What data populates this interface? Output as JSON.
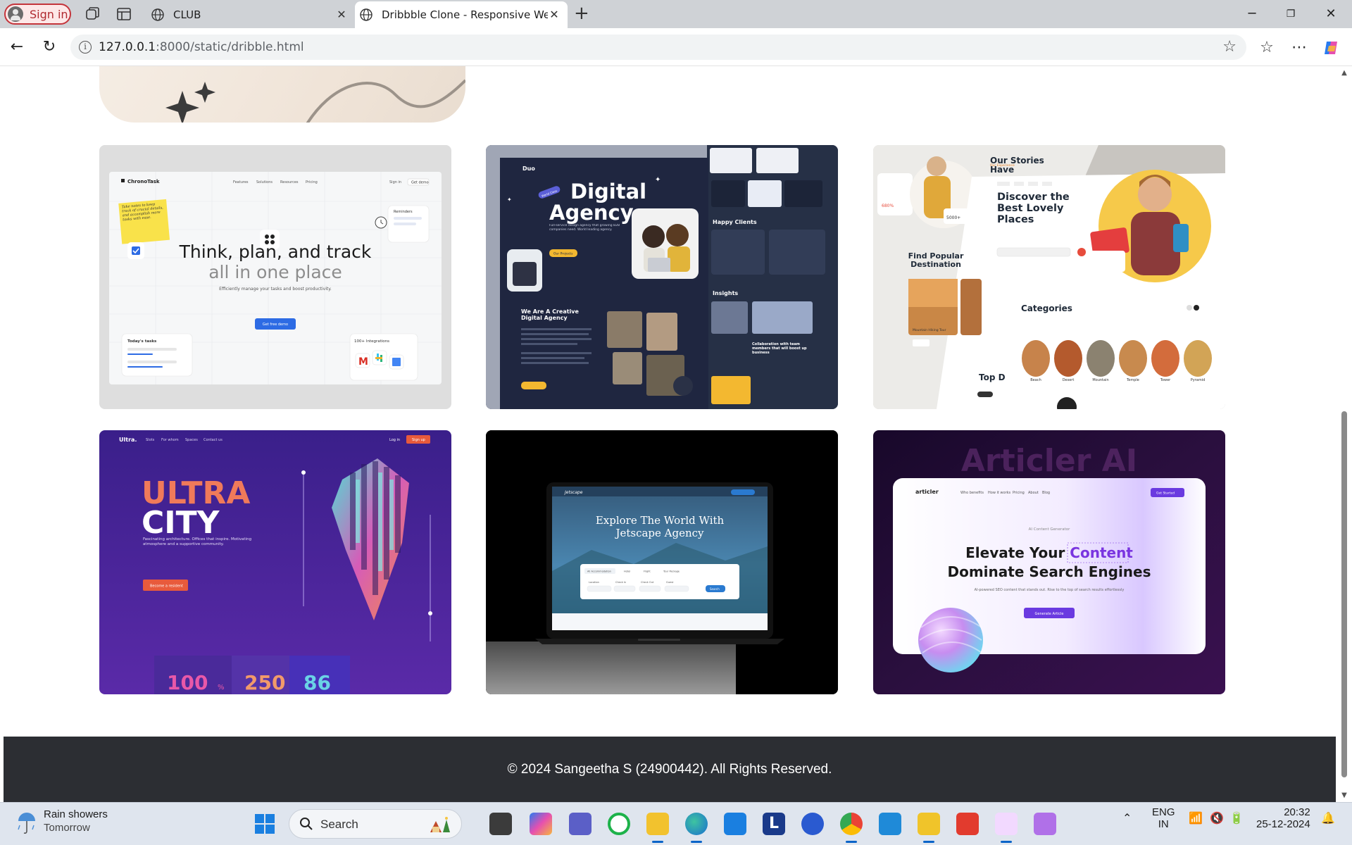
{
  "browser": {
    "signin_label": "Sign in",
    "tabs": [
      {
        "label": "CLUB",
        "active": false
      },
      {
        "label": "Dribbble Clone - Responsive Web",
        "active": true
      }
    ],
    "url_host": "127.0.0.1",
    "url_path": ":8000/static/dribble.html"
  },
  "shots": {
    "chronotask": {
      "brand": "ChronoTask",
      "nav": [
        "Features",
        "Solutions",
        "Resources",
        "Pricing"
      ],
      "signin": "Sign in",
      "cta_nav": "Get demo",
      "headline_1": "Think, plan, and track",
      "headline_2": "all in one place",
      "sub": "Efficiently manage your tasks and boost productivity.",
      "button": "Get free demo",
      "note": "Take notes to keep track of crucial details, and accomplish more tasks with ease.",
      "tasks_title": "Today's tasks",
      "integrations": "100+ Integrations",
      "reminders": "Reminders"
    },
    "digital": {
      "brand": "Duo",
      "headline_1": "Digital",
      "headline_2": "Agency",
      "sub": "Full-service design agency that growing B2B companies need. World leading agency.",
      "badge": "World Class",
      "button": "Our Projects",
      "section": "We Are A Creative Digital Agency",
      "clients": "Happy Clients",
      "insights": "Insights",
      "collab": "Collaboration with team members that will boost up business"
    },
    "travel": {
      "stories": "Our Stories Have Adventures",
      "headline": "Discover the Best Lovely Places",
      "popular": "Find Popular Destination",
      "categories": "Categories",
      "top": "Top D",
      "tour": "Mountain Hiking Tour",
      "stat_1": "680%",
      "stat_2": "5000+",
      "cats": [
        "Beach",
        "Desert",
        "Mountain",
        "Temple",
        "Tower",
        "Pyramid"
      ]
    },
    "ultra": {
      "brand": "Ultra.",
      "nav": [
        "Slots",
        "For whom",
        "Spaces",
        "Contact us"
      ],
      "login": "Log in",
      "signup": "Sign up",
      "headline_1": "ULTRA",
      "headline_2": "CITY",
      "sub": "Fascinating architecture. Offices that inspire. Motivating atmosphere and a supportive community.",
      "button": "Become a resident",
      "stats": [
        "100",
        "250",
        "86"
      ],
      "stat_suffix": "%"
    },
    "jetscape": {
      "brand": "Jetscape",
      "headline_1": "Explore The World With",
      "headline_2": "Jetscape Agency",
      "tabs": [
        "All Accommodation",
        "Hotel",
        "Flight",
        "Tour Package"
      ],
      "fields": [
        "Location",
        "Check In",
        "Check Out",
        "Guest"
      ],
      "button": "Search"
    },
    "articler": {
      "bg_text": "Articler AI",
      "brand": "articler",
      "nav": [
        "Who benefits",
        "How it works",
        "Pricing",
        "About",
        "Blog"
      ],
      "cta_nav": "Get Started",
      "kicker": "AI Content Generator",
      "headline_1a": "Elevate Your ",
      "headline_1b": "Content",
      "headline_2": "Dominate Search Engines",
      "sub": "AI-powered SEO content that stands out. Rise to the top of search results effortlessly",
      "button": "Generate Article"
    }
  },
  "footer": {
    "text": "© 2024 Sangeetha S (24900442). All Rights Reserved."
  },
  "taskbar": {
    "weather_title": "Rain showers",
    "weather_sub": "Tomorrow",
    "search_label": "Search",
    "lang_1": "ENG",
    "lang_2": "IN",
    "time": "20:32",
    "date": "25-12-2024"
  },
  "colors": {
    "accent": "#0a64c8",
    "footer_bg": "#2c2e33",
    "signin": "#c4343b"
  }
}
